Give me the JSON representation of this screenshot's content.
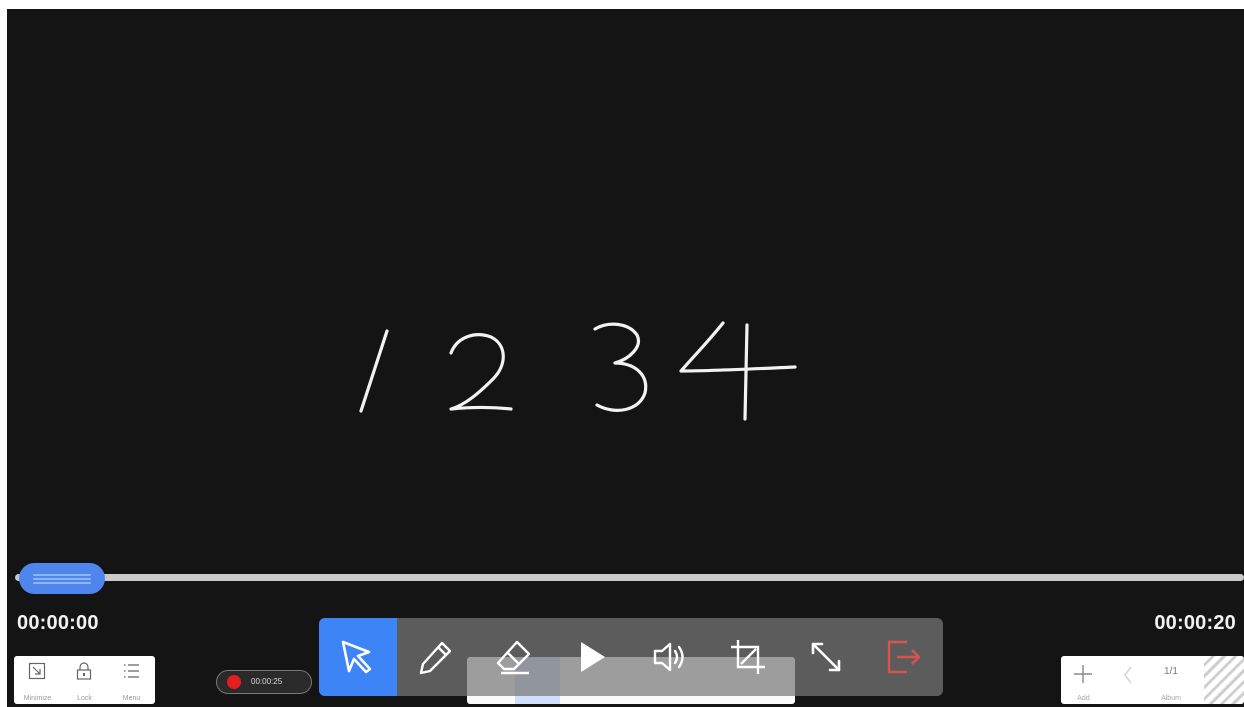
{
  "board": {
    "handwriting": "1234"
  },
  "player": {
    "current_time": "00:00:00",
    "total_time": "00:00:20",
    "progress": 0
  },
  "left_bar": {
    "items": [
      {
        "label": "Minimize",
        "icon": "minimize-icon"
      },
      {
        "label": "Lock",
        "icon": "lock-icon"
      },
      {
        "label": "Menu",
        "icon": "menu-icon"
      }
    ]
  },
  "recorder": {
    "text": "00:00:25",
    "status_color": "#e21f1f"
  },
  "toolbar": {
    "active": "select",
    "tools": [
      {
        "id": "select",
        "icon": "cursor-arrow-icon"
      },
      {
        "id": "pen",
        "icon": "pencil-icon"
      },
      {
        "id": "eraser",
        "icon": "eraser-icon"
      },
      {
        "id": "play",
        "icon": "play-icon"
      },
      {
        "id": "volume",
        "icon": "speaker-icon"
      },
      {
        "id": "crop",
        "icon": "crop-icon"
      },
      {
        "id": "resize",
        "icon": "resize-arrows-icon"
      },
      {
        "id": "exit",
        "icon": "exit-icon"
      }
    ],
    "accent": "#3d84f6",
    "exit_color": "#d9534f"
  },
  "right_bar": {
    "add_label": "Add",
    "page_indicator": "1/1",
    "page_label": "Album"
  }
}
